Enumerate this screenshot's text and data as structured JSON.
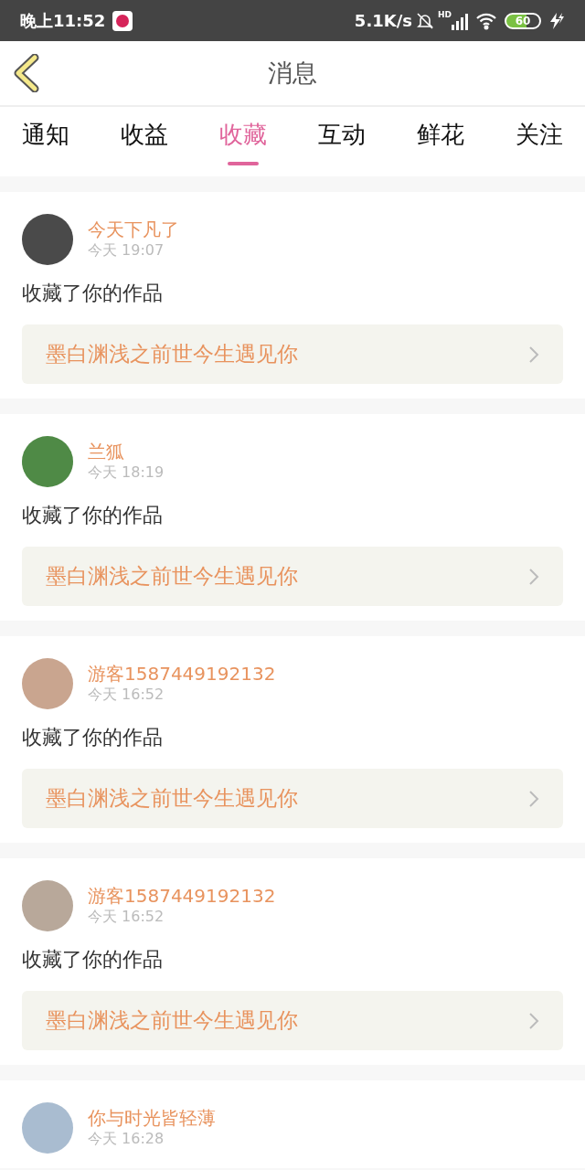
{
  "status_bar": {
    "time": "晚上11:52",
    "speed": "5.1K/s",
    "signal_label": "HD",
    "battery": "60"
  },
  "header": {
    "title": "消息"
  },
  "tabs": [
    {
      "label": "通知",
      "selected": false
    },
    {
      "label": "收益",
      "selected": false
    },
    {
      "label": "收藏",
      "selected": true
    },
    {
      "label": "互动",
      "selected": false
    },
    {
      "label": "鲜花",
      "selected": false
    },
    {
      "label": "关注",
      "selected": false
    }
  ],
  "messages": [
    {
      "user": "今天下凡了",
      "time": "今天 19:07",
      "action": "收藏了你的作品",
      "work": "墨白渊浅之前世今生遇见你"
    },
    {
      "user": "兰狐",
      "time": "今天 18:19",
      "action": "收藏了你的作品",
      "work": "墨白渊浅之前世今生遇见你"
    },
    {
      "user": "游客1587449192132",
      "time": "今天 16:52",
      "action": "收藏了你的作品",
      "work": "墨白渊浅之前世今生遇见你"
    },
    {
      "user": "游客1587449192132",
      "time": "今天 16:52",
      "action": "收藏了你的作品",
      "work": "墨白渊浅之前世今生遇见你"
    },
    {
      "user": "你与时光皆轻薄",
      "time": "今天 16:28"
    }
  ]
}
